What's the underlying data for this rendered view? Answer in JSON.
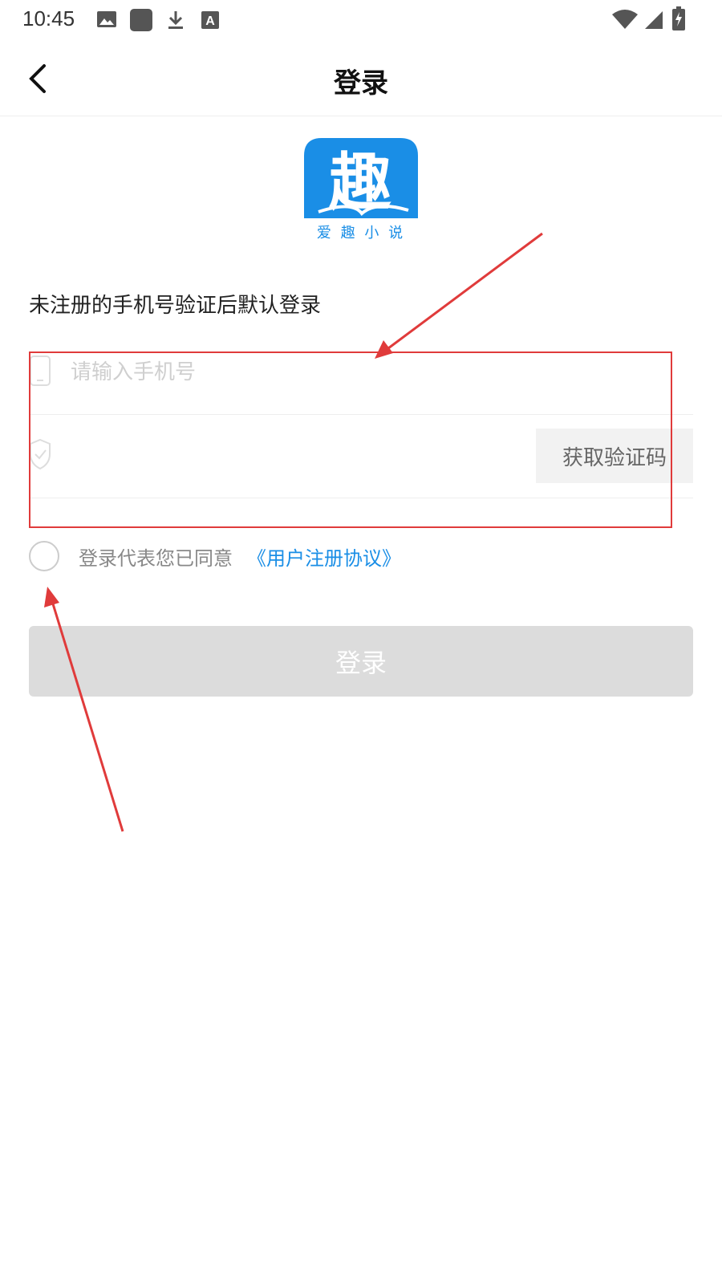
{
  "status_bar": {
    "time": "10:45",
    "icons": [
      "image-icon",
      "app-square-icon",
      "download-icon",
      "text-a-icon",
      "wifi-icon",
      "signal-icon",
      "battery-charging-icon"
    ]
  },
  "nav": {
    "back_icon": "chevron-left-icon",
    "title": "登录"
  },
  "logo": {
    "glyph": "趣",
    "caption": "爱 趣 小 说",
    "color": "#1a8ee6"
  },
  "form": {
    "hint": "未注册的手机号验证后默认登录",
    "phone": {
      "placeholder": "请输入手机号",
      "value": "",
      "icon": "phone-icon"
    },
    "code": {
      "placeholder": "",
      "value": "",
      "icon": "shield-check-icon",
      "button_label": "获取验证码"
    }
  },
  "agreement": {
    "text": "登录代表您已同意",
    "link": "《用户注册协议》",
    "checked": false
  },
  "login_button": {
    "label": "登录",
    "enabled": false
  },
  "colors": {
    "accent": "#1a8ee6",
    "annotation": "#e03b3b",
    "button_disabled": "#dcdcdc"
  }
}
